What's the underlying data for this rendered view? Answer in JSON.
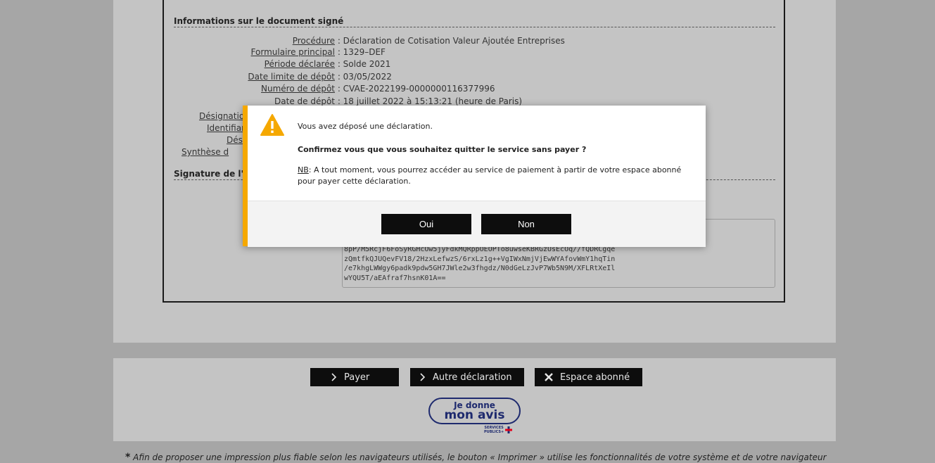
{
  "document_info": {
    "title": "Informations sur le document signé",
    "rows": [
      {
        "label": "Procédure",
        "value": "Déclaration de Cotisation Valeur Ajoutée Entreprises"
      },
      {
        "label": "Formulaire principal",
        "value": "1329–DEF"
      },
      {
        "label": "Période déclarée",
        "value": "Solde 2021"
      },
      {
        "label": "Date limite de dépôt",
        "value": "03/05/2022"
      },
      {
        "label": "Numéro de dépôt",
        "value": "CVAE-2022199-0000000116377996"
      },
      {
        "label": "Date de dépôt",
        "value": "18 juillet 2022 à 15:13:21 (heure de Paris)"
      }
    ],
    "hidden_labels": [
      "Désignatio",
      "Identifian",
      "Dés",
      "Synthèse d"
    ]
  },
  "signature": {
    "title": "Signature de l'ac",
    "lines": [
      "8pP/M5RcjF6FoSyRGHcOw5jyFdkMQRppOEOPTo8uwseKBRGzUsEcOq//fQDRCgqe",
      "zQmtfkQJUQevFV18/2HzxLefwzS/6rxLz1g++VgIWxNmjVjEwWYAfovWmY1hqTin",
      "/e7khgLWWgy6padk9pdw5GH7JWle2w3fhgdz/N0dGeLzJvP7Wb5N9M/XFLRtXeIl",
      "wYQU5T/aEAfraf7hsnK01A=="
    ]
  },
  "modal": {
    "icon": "warning-icon",
    "line1": "Vous avez déposé une déclaration.",
    "question": "Confirmez vous que vous souhaitez quitter le service sans payer ?",
    "nb_label": "NB",
    "nb_text": ": A tout moment, vous pourrez accéder au service de paiement à partir de votre espace abonné",
    "nb_text2": "pour payer cette déclaration.",
    "yes_label": "Oui",
    "no_label": "Non"
  },
  "actions": {
    "pay_label": "Payer",
    "other_label": "Autre déclaration",
    "space_label": "Espace abonné"
  },
  "feedback": {
    "line1": "Je donne",
    "line2": "mon avis",
    "logo_line1": "SERVICES",
    "logo_line2": "PUBLICS+"
  },
  "footnote": {
    "star": "*",
    "text": "Afin de proposer une impression plus fiable selon les navigateurs utilisés, le bouton « Imprimer » utilise les fonctionnalités de votre système et de votre navigateur"
  },
  "colors": {
    "overlay": "#a6a6a6",
    "accent": "#f5a800",
    "button": "#0d0d0d",
    "brand": "#1e2a6e"
  }
}
